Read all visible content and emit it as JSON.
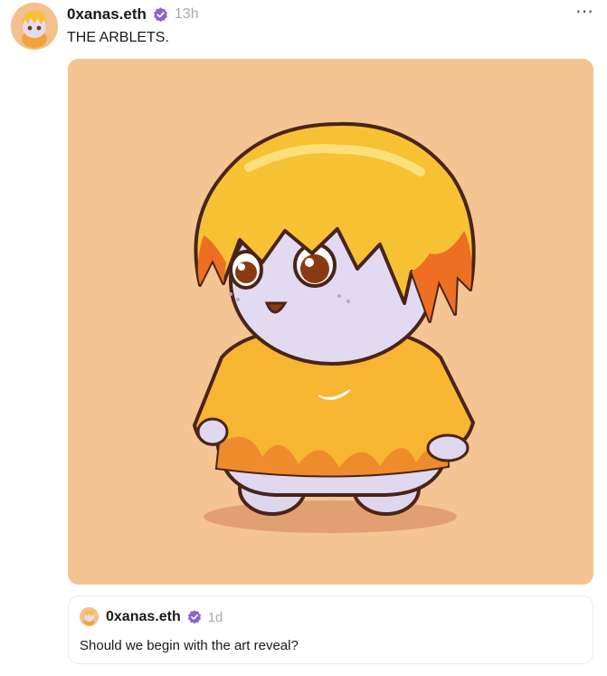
{
  "post": {
    "author": "0xanas.eth",
    "time": "13h",
    "text": "THE ARBLETS.",
    "more_icon": "⋯"
  },
  "media": {
    "type": "image",
    "subject": "cartoon character"
  },
  "quote": {
    "author": "0xanas.eth",
    "time": "1d",
    "text": "Should we begin with the art reveal?"
  },
  "colors": {
    "verified": "#8a63d2",
    "media_bg": "#f4c493",
    "muted_text": "#a9a9a9"
  }
}
